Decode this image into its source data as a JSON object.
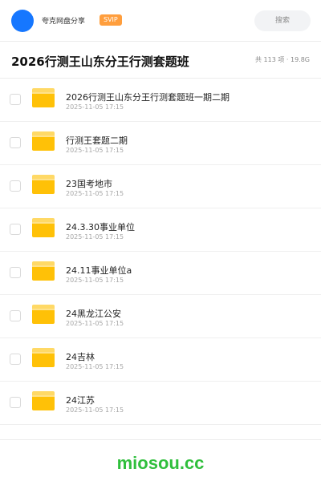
{
  "header": {
    "site_name": "夸克网盘分享",
    "badge": "SVIP",
    "search_label": "搜索"
  },
  "folder": {
    "title": "2026行测王山东分王行测套题班",
    "meta": "共 113 项 · 19.8G"
  },
  "items": [
    {
      "name": "2026行测王山东分王行测套题班一期二期",
      "date": "2025-11-05 17:15"
    },
    {
      "name": "行测王套题二期",
      "date": "2025-11-05 17:15"
    },
    {
      "name": "23国考地市",
      "date": "2025-11-05 17:15"
    },
    {
      "name": "24.3.30事业单位",
      "date": "2025-11-05 17:15"
    },
    {
      "name": "24.11事业单位a",
      "date": "2025-11-05 17:15"
    },
    {
      "name": "24黑龙江公安",
      "date": "2025-11-05 17:15"
    },
    {
      "name": "24吉林",
      "date": "2025-11-05 17:15"
    },
    {
      "name": "24江苏",
      "date": "2025-11-05 17:15"
    }
  ],
  "footer": {
    "watermark": "miosou.cc"
  },
  "colors": {
    "accent": "#1677ff",
    "badge": "#ff9e3d",
    "folder": "#ffc107",
    "watermark": "#2fbf3c"
  }
}
